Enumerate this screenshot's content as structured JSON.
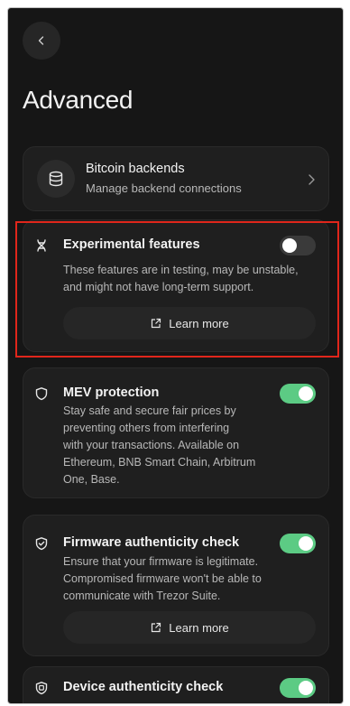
{
  "header": {
    "title": "Advanced"
  },
  "backends": {
    "title": "Bitcoin backends",
    "subtitle": "Manage backend connections"
  },
  "experimental": {
    "title": "Experimental features",
    "description_line1": "These features are in testing, may be unstable,",
    "description_line2": "and might not have long-term support.",
    "toggle_on": false,
    "learn_more": "Learn more"
  },
  "mev": {
    "title": "MEV protection",
    "lines": [
      "Stay safe and secure fair prices by",
      "preventing others from interfering",
      "with your transactions. Available on",
      "Ethereum, BNB Smart Chain, Arbitrum",
      "One, Base."
    ],
    "toggle_on": true
  },
  "firmware": {
    "title": "Firmware authenticity check",
    "lines": [
      "Ensure that your firmware is legitimate.",
      "Compromised firmware won't be able to",
      "communicate with Trezor Suite."
    ],
    "toggle_on": true,
    "learn_more": "Learn more"
  },
  "device": {
    "title": "Device authenticity check",
    "toggle_on": true
  },
  "colors": {
    "accent_green": "#5ccb84",
    "highlight_red": "#e0261b"
  }
}
